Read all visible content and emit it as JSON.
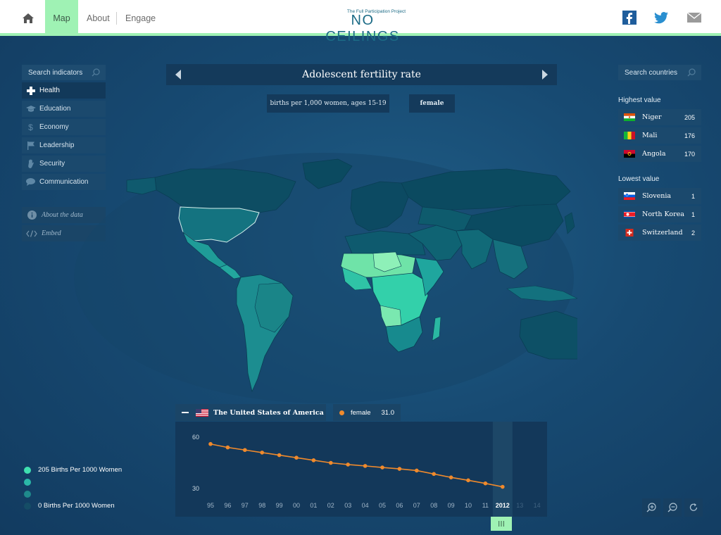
{
  "nav": {
    "home_icon": "home-icon",
    "items": [
      {
        "label": "Map",
        "active": true
      },
      {
        "label": "About"
      },
      {
        "label": "Engage"
      }
    ]
  },
  "logo": {
    "subtitle": "The Full Participation Project",
    "title": "NO CEILINGS"
  },
  "social": [
    "facebook-icon",
    "twitter-icon",
    "mail-icon"
  ],
  "sidebar": {
    "search_placeholder": "Search indicators",
    "indicators": [
      {
        "label": "Health",
        "icon": "health-cross-icon",
        "active": true
      },
      {
        "label": "Education",
        "icon": "graduation-cap-icon"
      },
      {
        "label": "Economy",
        "icon": "dollar-icon"
      },
      {
        "label": "Leadership",
        "icon": "flag-icon"
      },
      {
        "label": "Security",
        "icon": "hand-icon"
      },
      {
        "label": "Communication",
        "icon": "speech-bubble-icon"
      }
    ],
    "extras": [
      {
        "label": "About the data",
        "icon": "info-icon"
      },
      {
        "label": "Embed",
        "icon": "code-icon"
      }
    ]
  },
  "indicator": {
    "title": "Adolescent fertility rate",
    "unit": "births per 1,000 women, ages 15-19",
    "gender": "female"
  },
  "right_panel": {
    "search_placeholder": "Search countries",
    "highest_label": "Highest value",
    "highest": [
      {
        "name": "Niger",
        "value": "205",
        "flag": "niger"
      },
      {
        "name": "Mali",
        "value": "176",
        "flag": "mali"
      },
      {
        "name": "Angola",
        "value": "170",
        "flag": "angola"
      }
    ],
    "lowest_label": "Lowest value",
    "lowest": [
      {
        "name": "Slovenia",
        "value": "1",
        "flag": "slovenia"
      },
      {
        "name": "North Korea",
        "value": "1",
        "flag": "north-korea"
      },
      {
        "name": "Switzerland",
        "value": "2",
        "flag": "switzerland"
      }
    ]
  },
  "legend": {
    "max_label": "205 Births Per 1000 Women",
    "min_label": "0 Births Per 1000 Women",
    "colors": [
      "#3fe0b0",
      "#2bb8a8",
      "#1f8a8c",
      "#154d66"
    ]
  },
  "chart_header": {
    "country": "The United States of America",
    "series_name": "female",
    "current_value": "31.0"
  },
  "chart_data": {
    "type": "line",
    "x": [
      "95",
      "96",
      "97",
      "98",
      "99",
      "00",
      "01",
      "02",
      "03",
      "04",
      "05",
      "06",
      "07",
      "08",
      "09",
      "10",
      "11",
      "2012",
      "13",
      "14"
    ],
    "series": [
      {
        "name": "female",
        "values": [
          56,
          54,
          52.5,
          51,
          49.5,
          48,
          46.5,
          45,
          44,
          43.2,
          42.3,
          41.5,
          40.5,
          38.5,
          36.5,
          34.8,
          33,
          31.0
        ]
      }
    ],
    "y_ticks": [
      "60",
      "30"
    ],
    "ylim": [
      30,
      60
    ],
    "selected_x": "2012",
    "line_color": "#f08a2c"
  },
  "zoom": [
    "zoom-in-icon",
    "zoom-out-icon",
    "reset-icon"
  ]
}
